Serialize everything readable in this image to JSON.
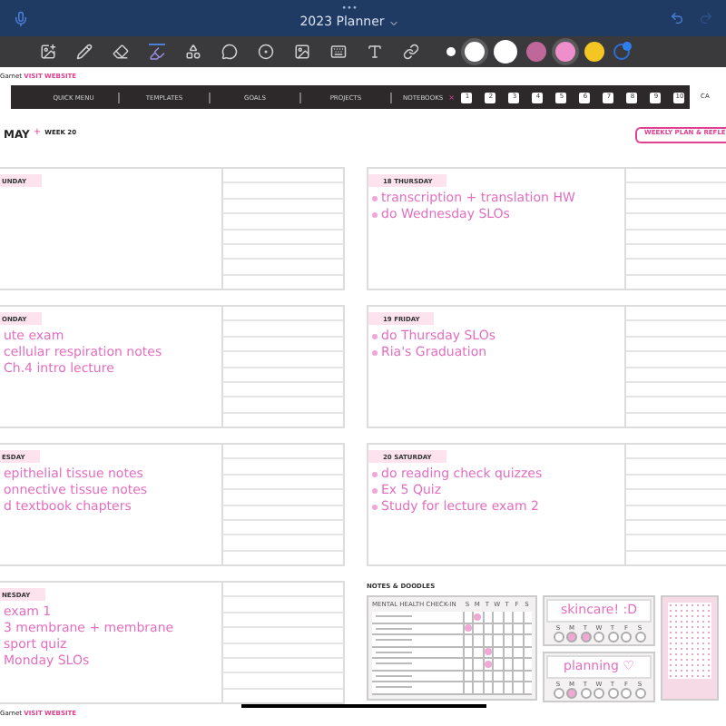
{
  "title_bar": {
    "dots": "•••",
    "title": "2023 Planner"
  },
  "tools": [
    {
      "selected": false
    },
    {
      "selected": false
    },
    {
      "selected": false
    },
    {
      "selected": true
    },
    {
      "selected": false
    },
    {
      "selected": false
    },
    {
      "selected": false
    },
    {
      "selected": false
    },
    {
      "selected": false
    },
    {
      "selected": false
    },
    {
      "selected": false
    }
  ],
  "swatches": [
    {
      "color": "#ffffff",
      "kind": "small",
      "selected": false
    },
    {
      "color": "#ffffff",
      "kind": "medium",
      "selected": true
    },
    {
      "color": "#ffffff",
      "kind": "large",
      "selected": false
    },
    {
      "color": "#c0679a",
      "kind": "medium",
      "selected": false
    },
    {
      "color": "#ee8fcc",
      "kind": "medium",
      "selected": true
    },
    {
      "color": "#f3c623",
      "kind": "medium",
      "selected": false
    }
  ],
  "credit_top": {
    "name": "Garnet",
    "link": "VISIT WEBSITE"
  },
  "nav": {
    "items": [
      "QUICK MENU",
      "TEMPLATES",
      "GOALS",
      "PROJECTS"
    ],
    "notebooks": "NOTEBOOKS",
    "close": "×",
    "numbers": [
      "1",
      "2",
      "3",
      "4",
      "5",
      "6",
      "7",
      "8",
      "9",
      "10"
    ],
    "tab": "CA"
  },
  "header": {
    "month": "MAY",
    "plus": "+",
    "week": "WEEK 20",
    "button": "WEEKLY PLAN & REFLE"
  },
  "left_days": [
    {
      "label": "UNDAY"
    },
    {
      "label": "ONDAY",
      "tasks": [
        "ute exam",
        "cellular respiration notes",
        "Ch.4 intro lecture"
      ]
    },
    {
      "label": "ESDAY",
      "tasks": [
        "epithelial tissue notes",
        "onnective tissue notes",
        "d textbook chapters"
      ]
    },
    {
      "label": "NESDAY",
      "tasks": [
        "exam 1",
        "3 membrane + membrane",
        "sport quiz",
        "Monday SLOs"
      ]
    }
  ],
  "right_days": [
    {
      "label": "18 THURSDAY",
      "tasks": [
        "transcription + translation HW",
        "do Wednesday SLOs"
      ]
    },
    {
      "label": "19 FRIDAY",
      "tasks": [
        "do Thursday SLOs",
        "Ria's Graduation"
      ]
    },
    {
      "label": "20 SATURDAY",
      "tasks": [
        "do reading check quizzes",
        "Ex 5 Quiz",
        "Study for lecture exam 2"
      ]
    }
  ],
  "notes": {
    "title": "NOTES & DOODLES",
    "tracker": {
      "title": "MENTAL HEALTH CHECK-IN",
      "days": [
        "S",
        "M",
        "T",
        "W",
        "T",
        "F",
        "S"
      ],
      "rows": [
        {
          "marks": [
            false,
            true,
            false,
            false,
            false,
            false,
            false
          ]
        },
        {
          "marks": [
            true,
            false,
            false,
            false,
            false,
            false,
            false
          ]
        },
        {
          "marks": [
            false,
            false,
            false,
            false,
            false,
            false,
            false
          ]
        },
        {
          "marks": [
            false,
            false,
            true,
            false,
            false,
            false,
            false
          ]
        },
        {
          "marks": [
            false,
            false,
            true,
            false,
            false,
            false,
            false
          ]
        },
        {
          "marks": [
            false,
            false,
            false,
            false,
            false,
            false,
            false
          ]
        },
        {
          "marks": [
            false,
            false,
            false,
            false,
            false,
            false,
            false
          ]
        }
      ]
    },
    "habits": [
      {
        "title": "skincare! :D",
        "days": [
          "S",
          "M",
          "T",
          "W",
          "T",
          "F",
          "S"
        ],
        "marks": [
          false,
          true,
          true,
          false,
          false,
          false,
          false
        ]
      },
      {
        "title": "planning ♡",
        "days": [
          "S",
          "M",
          "T",
          "W",
          "T",
          "F",
          "S"
        ],
        "marks": [
          false,
          true,
          false,
          false,
          false,
          false,
          false
        ]
      }
    ]
  },
  "credit_bottom": {
    "name": "Garnet",
    "link": "VISIT WEBSITE"
  }
}
